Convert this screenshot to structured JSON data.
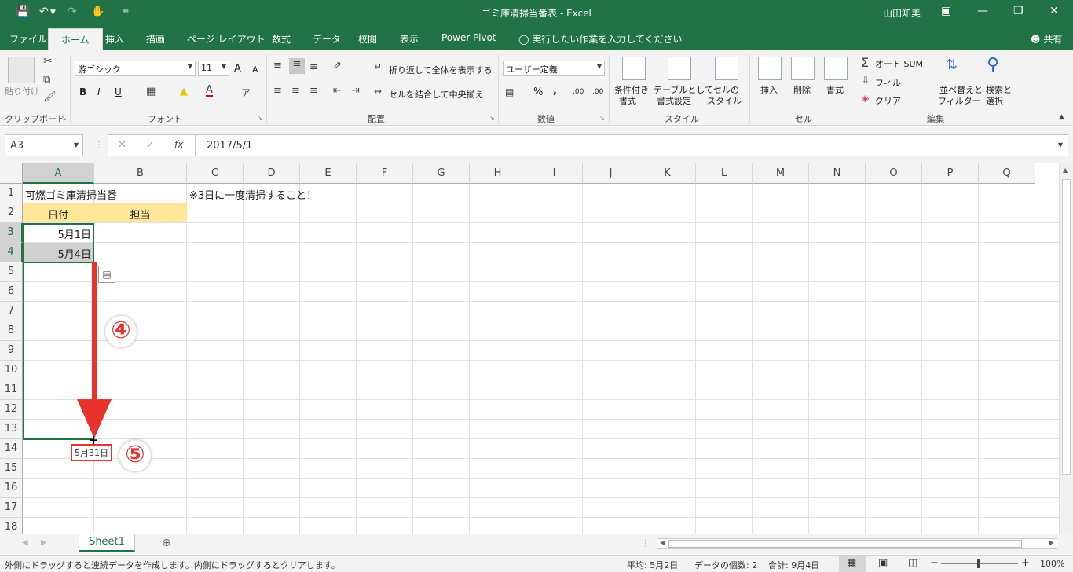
{
  "window": {
    "title": "ゴミ庫清掃当番表 - Excel",
    "user": "山田知美"
  },
  "tabs": [
    "ファイル",
    "ホーム",
    "挿入",
    "描画",
    "ページ レイアウト",
    "数式",
    "データ",
    "校閲",
    "表示",
    "Power Pivot"
  ],
  "active_tab": "ホーム",
  "tell_me": "実行したい作業を入力してください",
  "share": "共有",
  "ribbon": {
    "clipboard": {
      "paste": "貼り付け",
      "label": "クリップボード"
    },
    "font": {
      "name": "游ゴシック",
      "size": "11",
      "bold": "B",
      "italic": "I",
      "underline": "U",
      "grow": "A",
      "shrink": "A",
      "label": "フォント"
    },
    "alignment": {
      "wrap": "折り返して全体を表示する",
      "merge": "セルを結合して中央揃え",
      "label": "配置"
    },
    "number": {
      "format": "ユーザー定義",
      "percent": "%",
      "comma": ",",
      "inc_decimal": ".00",
      "dec_decimal": ".00",
      "label": "数値"
    },
    "styles": {
      "conditional": [
        "条件付き",
        "書式"
      ],
      "table": [
        "テーブルとして",
        "書式設定"
      ],
      "cell": [
        "セルの",
        "スタイル"
      ],
      "label": "スタイル"
    },
    "cells": {
      "insert": "挿入",
      "delete": "削除",
      "format": "書式",
      "label": "セル"
    },
    "editing": {
      "autosum": "オート SUM",
      "fill": "フィル",
      "clear": "クリア",
      "sort": [
        "並べ替えと",
        "フィルター"
      ],
      "find": [
        "検索と",
        "選択"
      ],
      "label": "編集"
    }
  },
  "formula_bar": {
    "name_box": "A3",
    "fx": "fx",
    "value": "2017/5/1"
  },
  "columns": [
    "A",
    "B",
    "C",
    "D",
    "E",
    "F",
    "G",
    "H",
    "I",
    "J",
    "K",
    "L",
    "M",
    "N",
    "O",
    "P",
    "Q"
  ],
  "rows": [
    "1",
    "2",
    "3",
    "4",
    "5",
    "6",
    "7",
    "8",
    "9",
    "10",
    "11",
    "12",
    "13",
    "14",
    "15",
    "16",
    "17",
    "18"
  ],
  "cells": {
    "A1": "可燃ゴミ庫清掃当番",
    "C1": "※3日に一度清掃すること！",
    "A2": "日付",
    "B2": "担当",
    "A3": "5月1日",
    "A4": "5月4日"
  },
  "annotations": {
    "step4": "④",
    "step5": "⑤",
    "drag_tooltip": "5月31日"
  },
  "sheet_tab": "Sheet1",
  "status": {
    "message": "外側にドラッグすると連続データを作成します。内側にドラッグするとクリアします。",
    "average": "平均: 5月2日",
    "count": "データの個数: 2",
    "sum": "合計: 9月4日",
    "zoom": "100%"
  },
  "colors": {
    "excel_green": "#217346",
    "header_fill": "#ffe699",
    "selection_fill": "#d0d0d0",
    "annotation_red": "#e8322b"
  }
}
